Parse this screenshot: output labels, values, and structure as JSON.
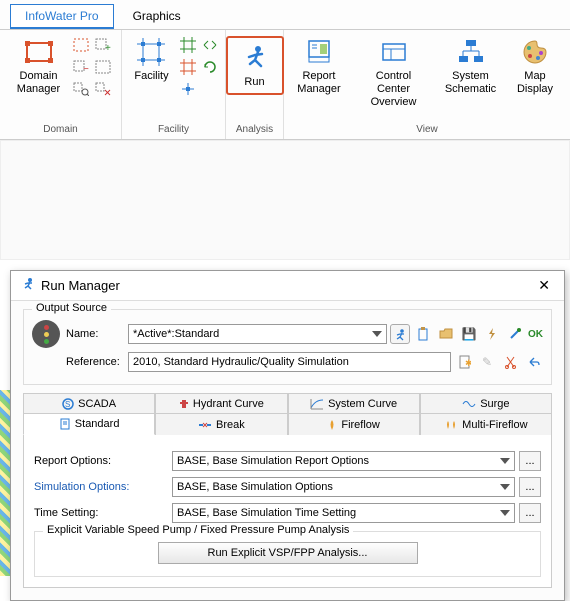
{
  "ribbon": {
    "tabs": {
      "infowater": "InfoWater Pro",
      "graphics": "Graphics"
    },
    "domain": {
      "title": "Domain",
      "manager": "Domain\nManager"
    },
    "facility": {
      "title": "Facility",
      "label": "Facility"
    },
    "analysis": {
      "title": "Analysis",
      "run": "Run"
    },
    "view": {
      "title": "View",
      "report": "Report\nManager",
      "control": "Control Center\nOverview",
      "system": "System\nSchematic",
      "map": "Map\nDisplay"
    }
  },
  "dialog": {
    "title": "Run Manager",
    "output_source": "Output Source",
    "name_lbl": "Name:",
    "name_val": "*Active*:Standard",
    "ref_lbl": "Reference:",
    "ref_val": "2010, Standard Hydraulic/Quality Simulation",
    "ok": "OK",
    "tabs_top": {
      "scada": "SCADA",
      "hydrant": "Hydrant Curve",
      "system": "System Curve",
      "surge": "Surge"
    },
    "tabs_bottom": {
      "standard": "Standard",
      "break": "Break",
      "fireflow": "Fireflow",
      "multi": "Multi-Fireflow"
    },
    "report_opt_lbl": "Report Options:",
    "report_opt_val": "BASE, Base Simulation Report Options",
    "sim_opt_lbl": "Simulation Options:",
    "sim_opt_val": "BASE, Base Simulation Options",
    "time_lbl": "Time Setting:",
    "time_val": "BASE, Base Simulation Time Setting",
    "explicit_group": "Explicit Variable Speed Pump / Fixed Pressure Pump Analysis",
    "run_explicit": "Run Explicit VSP/FPP Analysis..."
  }
}
